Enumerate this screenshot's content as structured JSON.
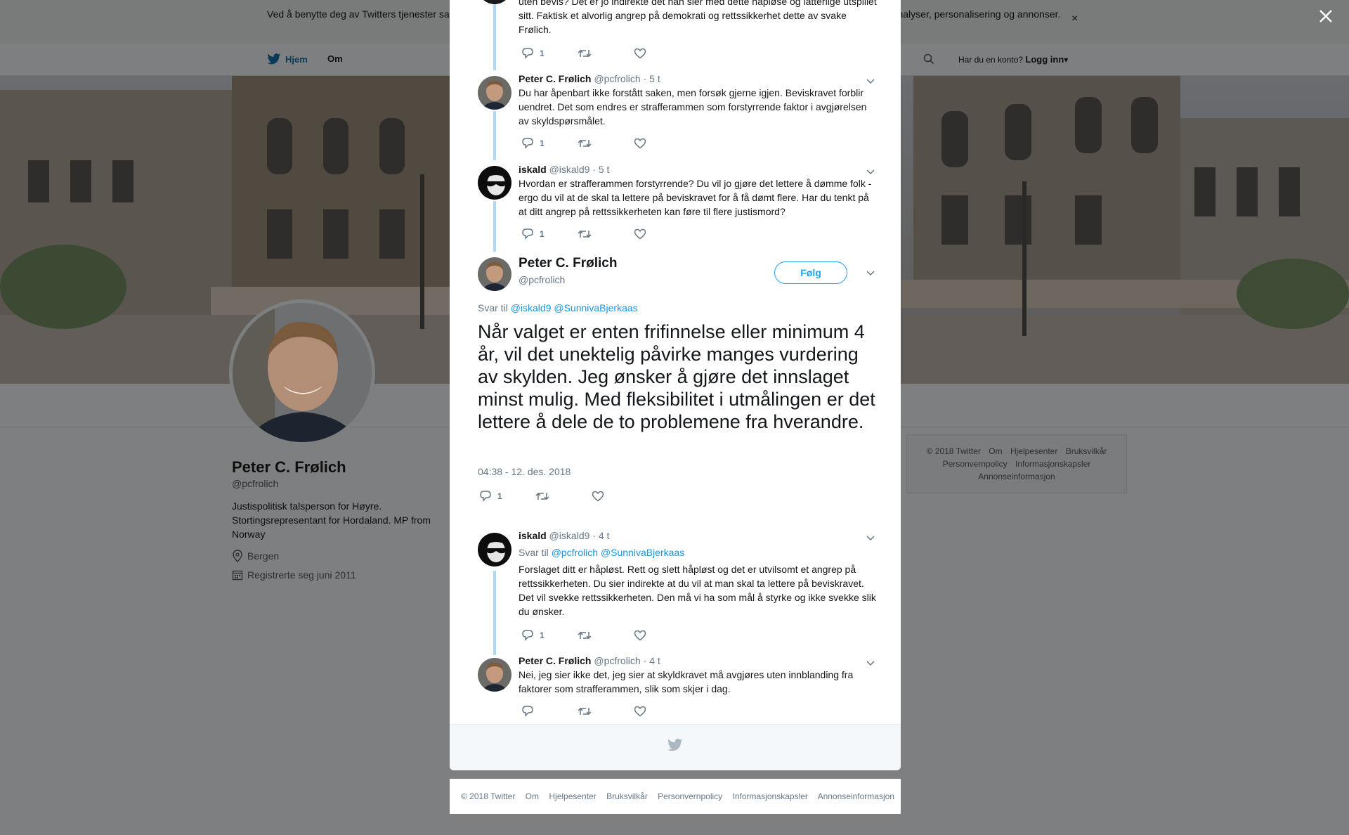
{
  "cookie_banner": {
    "text": "Ved å benytte deg av Twitters tjenester samtykker du til vår bruk av informasjonskapsler. Vi og våre partnere bruker informasjonskapsler til bl.a. analyser, personalisering og annonser.",
    "close": "×"
  },
  "nav": {
    "home": "Hjem",
    "about": "Om",
    "account_prompt": "Har du en konto?",
    "login": "Logg inn"
  },
  "profile": {
    "name": "Peter C. Frølich",
    "handle": "@pcfrolich",
    "bio": "Justispolitisk talsperson for Høyre. Stortingsrepresentant for Hordaland. MP from Norway",
    "location": "Bergen",
    "joined": "Registrerte seg juni 2011"
  },
  "side_footer": {
    "items": [
      "© 2018 Twitter",
      "Om",
      "Hjelpesenter",
      "Bruksvilkår",
      "Personvernpolicy",
      "Informasjonskapsler",
      "Annonseinformasjon"
    ]
  },
  "thread": {
    "tweet0": {
      "text": "uten bevis? Det er jo indirekte det han sier med dette håpløse og latterlige utspillet sitt. Faktisk et alvorlig angrep på demokrati og rettssikkerhet dette av svake Frølich.",
      "replies": "1"
    },
    "tweet1": {
      "name": "Peter C. Frølich",
      "handle": "@pcfrolich",
      "time": "· 5 t",
      "text": "Du har åpenbart ikke forstått saken, men forsøk gjerne igjen. Beviskravet forblir uendret. Det som endres er strafferammen som forstyrrende faktor i avgjørelsen av skyldspørsmålet.",
      "replies": "1"
    },
    "tweet2": {
      "name": "iskald",
      "handle": "@iskald9",
      "time": "· 5 t",
      "text": "Hvordan er strafferammen forstyrrende? Du vil jo gjøre det lettere å dømme folk - ergo du vil at de skal ta lettere på beviskravet for å få dømt flere. Har du tenkt på at ditt angrep på rettssikkerheten kan føre til flere justismord?",
      "replies": "1"
    },
    "main": {
      "name": "Peter C. Frølich",
      "handle": "@pcfrolich",
      "follow": "Følg",
      "reply_prefix": "Svar til",
      "reply_mentions": "@iskald9 @SunnivaBjerkaas",
      "text": "Når valget er enten frifinnelse eller minimum 4 år, vil det unektelig påvirke manges vurdering av skylden. Jeg ønsker å gjøre det innslaget minst mulig. Med fleksibilitet i utmålingen er det lettere å dele de to problemene fra hverandre.",
      "date": "04:38 - 12. des. 2018",
      "replies": "1"
    },
    "tweet3": {
      "name": "iskald",
      "handle": "@iskald9",
      "time": "· 4 t",
      "reply_prefix": "Svar til",
      "reply_mentions": "@pcfrolich @SunnivaBjerkaas",
      "text": "Forslaget ditt er håpløst. Rett og slett håpløst og det er utvilsomt et angrep på rettssikkerheten. Du sier indirekte at du vil at man skal ta lettere på beviskravet. Det vil svekke rettssikkerheten. Den må vi ha som mål å styrke og ikke svekke slik du ønsker.",
      "replies": "1"
    },
    "tweet4": {
      "name": "Peter C. Frølich",
      "handle": "@pcfrolich",
      "time": "· 4 t",
      "text": "Nei, jeg sier ikke det, jeg sier at skyldkravet må avgjøres uten innblanding fra faktorer som strafferammen, slik som skjer i dag.",
      "replies": ""
    }
  },
  "bottom_footer": {
    "items": [
      "© 2018 Twitter",
      "Om",
      "Hjelpesenter",
      "Bruksvilkår",
      "Personvernpolicy",
      "Informasjonskapsler",
      "Annonseinformasjon"
    ]
  },
  "colors": {
    "accent": "#1da1f2",
    "link": "#1b95e0",
    "thread_line": "#b0d8f2",
    "overlay": "#7d7f80"
  }
}
